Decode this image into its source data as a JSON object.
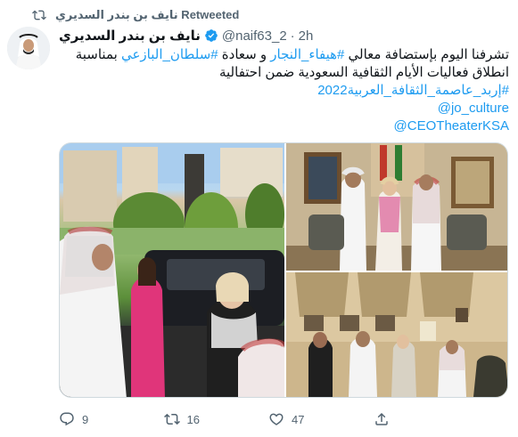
{
  "retweet": {
    "label": "نايف بن بندر السديري Retweeted"
  },
  "author": {
    "name": "نايف بن بندر السديري",
    "handle": "@naif63_2",
    "separator": "·",
    "time": "2h"
  },
  "tweet": {
    "line1": {
      "prefix": "تشرفنا اليوم بإستضافة معالي ",
      "link1": "#هيفاء_النجار",
      "middle": " و سعادة ",
      "link2": "#سلطان_البازعي",
      "suffix": " بمناسبة"
    },
    "line2": "انطلاق فعاليات الأيام الثقافية السعودية ضمن احتفالية",
    "hashtag": "#إربد_عاصمة_الثقافة_العربية2022",
    "mention1": "@jo_culture",
    "mention2": "@CEOTheaterKSA"
  },
  "actions": {
    "reply_count": "9",
    "retweet_count": "16",
    "like_count": "47"
  },
  "colors": {
    "link": "#1d9bf0",
    "verified": "#1d9bf0",
    "muted": "#536471"
  }
}
